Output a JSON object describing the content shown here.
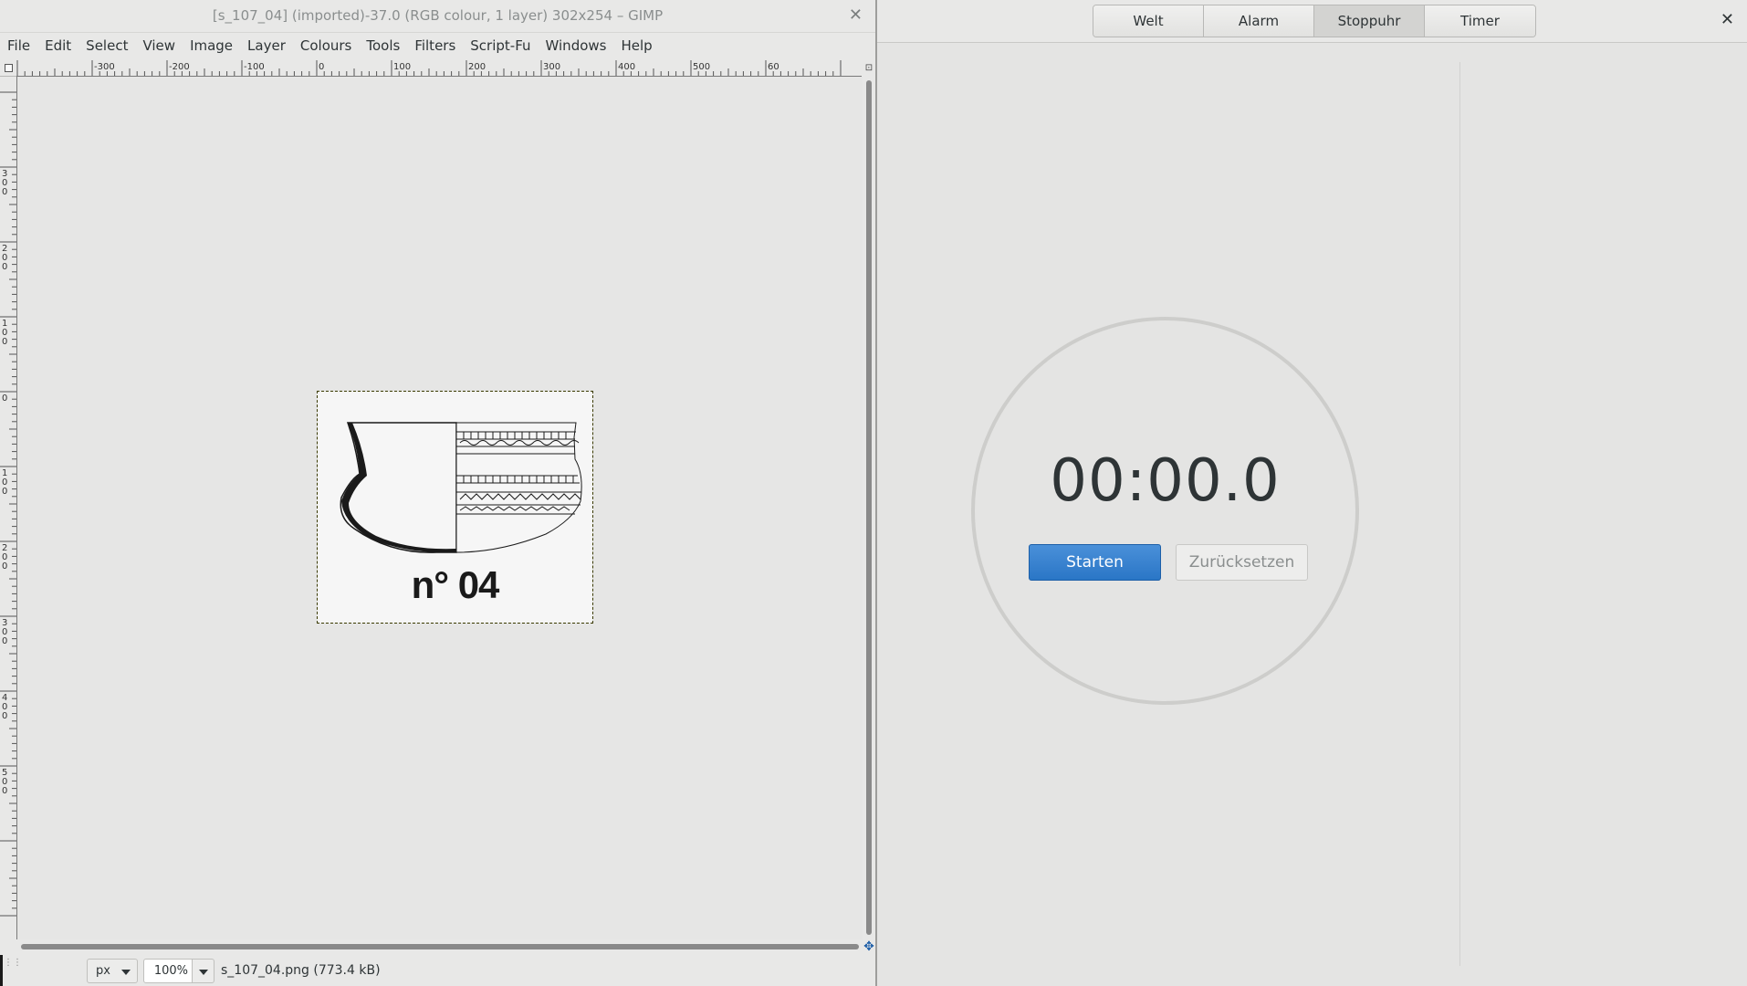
{
  "gimp": {
    "title": "[s_107_04] (imported)-37.0 (RGB colour, 1 layer) 302x254 – GIMP",
    "close_icon": "close-icon",
    "menu": [
      "File",
      "Edit",
      "Select",
      "View",
      "Image",
      "Layer",
      "Colours",
      "Tools",
      "Filters",
      "Script-Fu",
      "Windows",
      "Help"
    ],
    "hruler_labels": [
      "-300",
      "-200",
      "-100",
      "0",
      "100",
      "200",
      "300",
      "400",
      "500",
      "60"
    ],
    "vruler_labels": [
      "3\n0\n0",
      "2\n0\n0",
      "1\n0\n0",
      "0",
      "1\n0\n0",
      "2\n0\n0",
      "3\n0\n0",
      "4\n0\n0",
      "5\n0\n0"
    ],
    "image": {
      "caption": "n° 04"
    },
    "statusbar": {
      "unit": "px",
      "zoom": "100%",
      "file_info": "s_107_04.png (773.4 kB)"
    }
  },
  "clocks": {
    "tabs": [
      "Welt",
      "Alarm",
      "Stoppuhr",
      "Timer"
    ],
    "active_tab": "Stoppuhr",
    "stopwatch": {
      "time": "00:00.0",
      "start_label": "Starten",
      "reset_label": "Zurücksetzen"
    },
    "accent_color": "#2a76c6"
  }
}
